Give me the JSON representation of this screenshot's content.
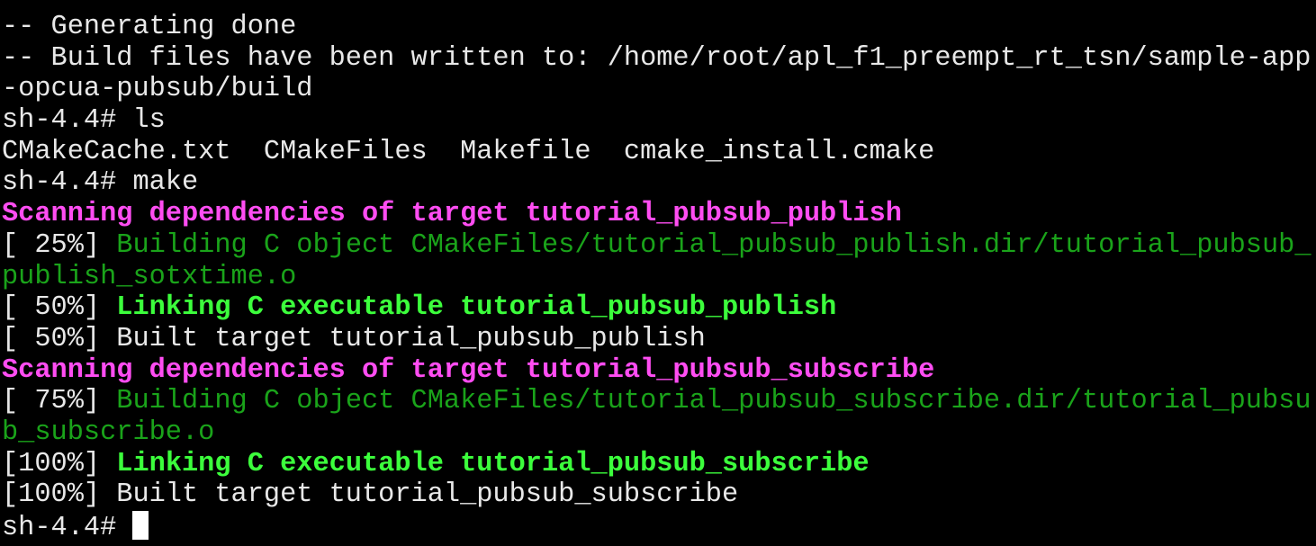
{
  "terminal": {
    "lines": [
      {
        "segments": [
          {
            "text": "-- Generating done",
            "style": "white"
          }
        ]
      },
      {
        "segments": [
          {
            "text": "-- Build files have been written to: /home/root/apl_f1_preempt_rt_tsn/sample-app",
            "style": "white"
          }
        ]
      },
      {
        "segments": [
          {
            "text": "-opcua-pubsub/build",
            "style": "white"
          }
        ]
      },
      {
        "segments": [
          {
            "text": "sh-4.4# ls",
            "style": "white"
          }
        ]
      },
      {
        "segments": [
          {
            "text": "CMakeCache.txt  CMakeFiles  Makefile  cmake_install.cmake",
            "style": "white"
          }
        ]
      },
      {
        "segments": [
          {
            "text": "sh-4.4# make",
            "style": "white"
          }
        ]
      },
      {
        "segments": [
          {
            "text": "Scanning dependencies of target tutorial_pubsub_publish",
            "style": "magenta"
          }
        ]
      },
      {
        "segments": [
          {
            "text": "[ 25%] ",
            "style": "white"
          },
          {
            "text": "Building C object CMakeFiles/tutorial_pubsub_publish.dir/tutorial_pubsub_",
            "style": "green"
          }
        ]
      },
      {
        "segments": [
          {
            "text": "publish_sotxtime.o",
            "style": "green"
          }
        ]
      },
      {
        "segments": [
          {
            "text": "[ 50%] ",
            "style": "white"
          },
          {
            "text": "Linking C executable tutorial_pubsub_publish",
            "style": "lgreen"
          }
        ]
      },
      {
        "segments": [
          {
            "text": "[ 50%] Built target tutorial_pubsub_publish",
            "style": "white"
          }
        ]
      },
      {
        "segments": [
          {
            "text": "Scanning dependencies of target tutorial_pubsub_subscribe",
            "style": "magenta"
          }
        ]
      },
      {
        "segments": [
          {
            "text": "[ 75%] ",
            "style": "white"
          },
          {
            "text": "Building C object CMakeFiles/tutorial_pubsub_subscribe.dir/tutorial_pubsu",
            "style": "green"
          }
        ]
      },
      {
        "segments": [
          {
            "text": "b_subscribe.o",
            "style": "green"
          }
        ]
      },
      {
        "segments": [
          {
            "text": "[100%] ",
            "style": "white"
          },
          {
            "text": "Linking C executable tutorial_pubsub_subscribe",
            "style": "lgreen"
          }
        ]
      },
      {
        "segments": [
          {
            "text": "[100%] Built target tutorial_pubsub_subscribe",
            "style": "white"
          }
        ]
      }
    ],
    "prompt": "sh-4.4# ",
    "colors": {
      "background": "#000000",
      "text": "#e8e8e8",
      "magenta": "#ff4df2",
      "green": "#1aa31a",
      "bright_green": "#3cff3c",
      "cursor": "#ffffff"
    }
  }
}
